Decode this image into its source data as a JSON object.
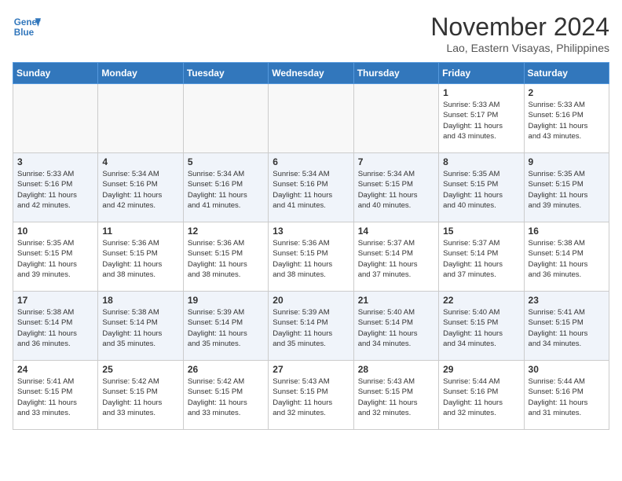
{
  "header": {
    "logo_line1": "General",
    "logo_line2": "Blue",
    "month": "November 2024",
    "location": "Lao, Eastern Visayas, Philippines"
  },
  "weekdays": [
    "Sunday",
    "Monday",
    "Tuesday",
    "Wednesday",
    "Thursday",
    "Friday",
    "Saturday"
  ],
  "weeks": [
    [
      {
        "day": "",
        "info": ""
      },
      {
        "day": "",
        "info": ""
      },
      {
        "day": "",
        "info": ""
      },
      {
        "day": "",
        "info": ""
      },
      {
        "day": "",
        "info": ""
      },
      {
        "day": "1",
        "info": "Sunrise: 5:33 AM\nSunset: 5:17 PM\nDaylight: 11 hours\nand 43 minutes."
      },
      {
        "day": "2",
        "info": "Sunrise: 5:33 AM\nSunset: 5:16 PM\nDaylight: 11 hours\nand 43 minutes."
      }
    ],
    [
      {
        "day": "3",
        "info": "Sunrise: 5:33 AM\nSunset: 5:16 PM\nDaylight: 11 hours\nand 42 minutes."
      },
      {
        "day": "4",
        "info": "Sunrise: 5:34 AM\nSunset: 5:16 PM\nDaylight: 11 hours\nand 42 minutes."
      },
      {
        "day": "5",
        "info": "Sunrise: 5:34 AM\nSunset: 5:16 PM\nDaylight: 11 hours\nand 41 minutes."
      },
      {
        "day": "6",
        "info": "Sunrise: 5:34 AM\nSunset: 5:16 PM\nDaylight: 11 hours\nand 41 minutes."
      },
      {
        "day": "7",
        "info": "Sunrise: 5:34 AM\nSunset: 5:15 PM\nDaylight: 11 hours\nand 40 minutes."
      },
      {
        "day": "8",
        "info": "Sunrise: 5:35 AM\nSunset: 5:15 PM\nDaylight: 11 hours\nand 40 minutes."
      },
      {
        "day": "9",
        "info": "Sunrise: 5:35 AM\nSunset: 5:15 PM\nDaylight: 11 hours\nand 39 minutes."
      }
    ],
    [
      {
        "day": "10",
        "info": "Sunrise: 5:35 AM\nSunset: 5:15 PM\nDaylight: 11 hours\nand 39 minutes."
      },
      {
        "day": "11",
        "info": "Sunrise: 5:36 AM\nSunset: 5:15 PM\nDaylight: 11 hours\nand 38 minutes."
      },
      {
        "day": "12",
        "info": "Sunrise: 5:36 AM\nSunset: 5:15 PM\nDaylight: 11 hours\nand 38 minutes."
      },
      {
        "day": "13",
        "info": "Sunrise: 5:36 AM\nSunset: 5:15 PM\nDaylight: 11 hours\nand 38 minutes."
      },
      {
        "day": "14",
        "info": "Sunrise: 5:37 AM\nSunset: 5:14 PM\nDaylight: 11 hours\nand 37 minutes."
      },
      {
        "day": "15",
        "info": "Sunrise: 5:37 AM\nSunset: 5:14 PM\nDaylight: 11 hours\nand 37 minutes."
      },
      {
        "day": "16",
        "info": "Sunrise: 5:38 AM\nSunset: 5:14 PM\nDaylight: 11 hours\nand 36 minutes."
      }
    ],
    [
      {
        "day": "17",
        "info": "Sunrise: 5:38 AM\nSunset: 5:14 PM\nDaylight: 11 hours\nand 36 minutes."
      },
      {
        "day": "18",
        "info": "Sunrise: 5:38 AM\nSunset: 5:14 PM\nDaylight: 11 hours\nand 35 minutes."
      },
      {
        "day": "19",
        "info": "Sunrise: 5:39 AM\nSunset: 5:14 PM\nDaylight: 11 hours\nand 35 minutes."
      },
      {
        "day": "20",
        "info": "Sunrise: 5:39 AM\nSunset: 5:14 PM\nDaylight: 11 hours\nand 35 minutes."
      },
      {
        "day": "21",
        "info": "Sunrise: 5:40 AM\nSunset: 5:14 PM\nDaylight: 11 hours\nand 34 minutes."
      },
      {
        "day": "22",
        "info": "Sunrise: 5:40 AM\nSunset: 5:15 PM\nDaylight: 11 hours\nand 34 minutes."
      },
      {
        "day": "23",
        "info": "Sunrise: 5:41 AM\nSunset: 5:15 PM\nDaylight: 11 hours\nand 34 minutes."
      }
    ],
    [
      {
        "day": "24",
        "info": "Sunrise: 5:41 AM\nSunset: 5:15 PM\nDaylight: 11 hours\nand 33 minutes."
      },
      {
        "day": "25",
        "info": "Sunrise: 5:42 AM\nSunset: 5:15 PM\nDaylight: 11 hours\nand 33 minutes."
      },
      {
        "day": "26",
        "info": "Sunrise: 5:42 AM\nSunset: 5:15 PM\nDaylight: 11 hours\nand 33 minutes."
      },
      {
        "day": "27",
        "info": "Sunrise: 5:43 AM\nSunset: 5:15 PM\nDaylight: 11 hours\nand 32 minutes."
      },
      {
        "day": "28",
        "info": "Sunrise: 5:43 AM\nSunset: 5:15 PM\nDaylight: 11 hours\nand 32 minutes."
      },
      {
        "day": "29",
        "info": "Sunrise: 5:44 AM\nSunset: 5:16 PM\nDaylight: 11 hours\nand 32 minutes."
      },
      {
        "day": "30",
        "info": "Sunrise: 5:44 AM\nSunset: 5:16 PM\nDaylight: 11 hours\nand 31 minutes."
      }
    ]
  ]
}
